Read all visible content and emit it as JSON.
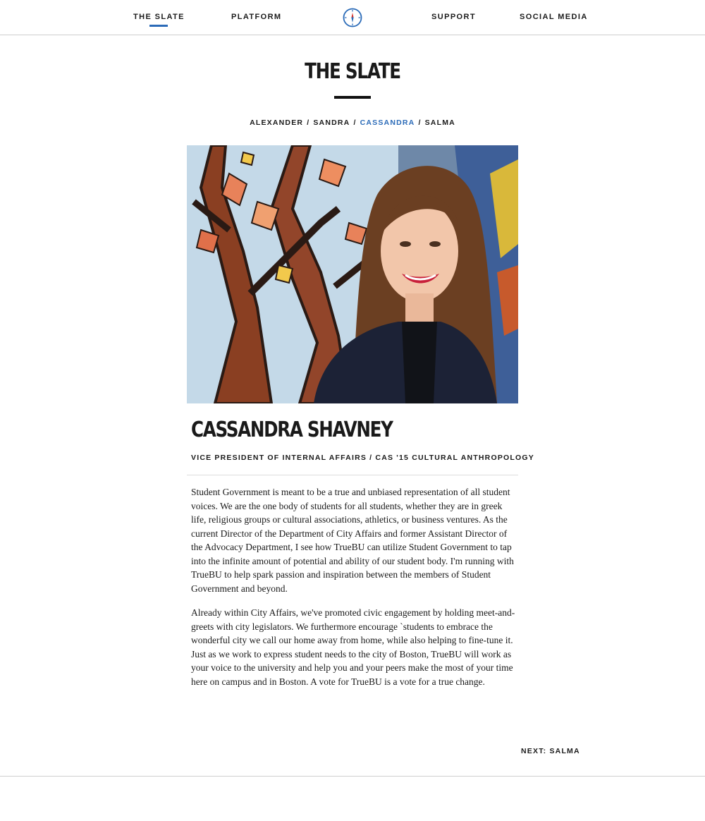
{
  "nav": {
    "items": [
      {
        "label": "THE SLATE",
        "active": true
      },
      {
        "label": "PLATFORM",
        "active": false
      },
      {
        "label": "SUPPORT",
        "active": false
      },
      {
        "label": "SOCIAL MEDIA",
        "active": false
      }
    ],
    "logo_icon": "compass-logo-icon"
  },
  "page": {
    "title": "THE SLATE"
  },
  "slate_nav": {
    "members": [
      "ALEXANDER",
      "SANDRA",
      "CASSANDRA",
      "SALMA"
    ],
    "separator": "/",
    "current": "CASSANDRA"
  },
  "profile": {
    "photo_icon": "portrait-photo",
    "name": "CASSANDRA SHAVNEY",
    "role": "VICE PRESIDENT OF INTERNAL AFFAIRS / CAS '15 CULTURAL ANTHROPOLOGY",
    "bio": [
      "Student Government is meant to be a true and unbiased representation of all student voices. We are the one body of students for all students, whether they are in greek life, religious groups or cultural associations, athletics, or business ventures. As the current Director of the Department of City Affairs and former Assistant Director of the Advocacy Department, I see how TrueBU can utilize Student Government to tap into the infinite amount of potential and ability of our student body. I'm running with TrueBU to help spark passion and inspiration between the members of Student Government and beyond.",
      "Already within City Affairs, we've promoted civic engagement by holding meet-and-greets with city legislators. We furthermore encourage `students to embrace the wonderful city we call our home away from home, while also helping to fine-tune it. Just as we work to express student needs to the city of Boston, TrueBU will work as your voice to the university and help you and your peers make the most of your time here on campus and in Boston. A vote for TrueBU is a vote for a true change."
    ]
  },
  "footer": {
    "next_label": "NEXT: SALMA"
  },
  "colors": {
    "accent": "#2b6bb8",
    "text": "#1a1a1a",
    "divider": "#cfcfcf"
  }
}
